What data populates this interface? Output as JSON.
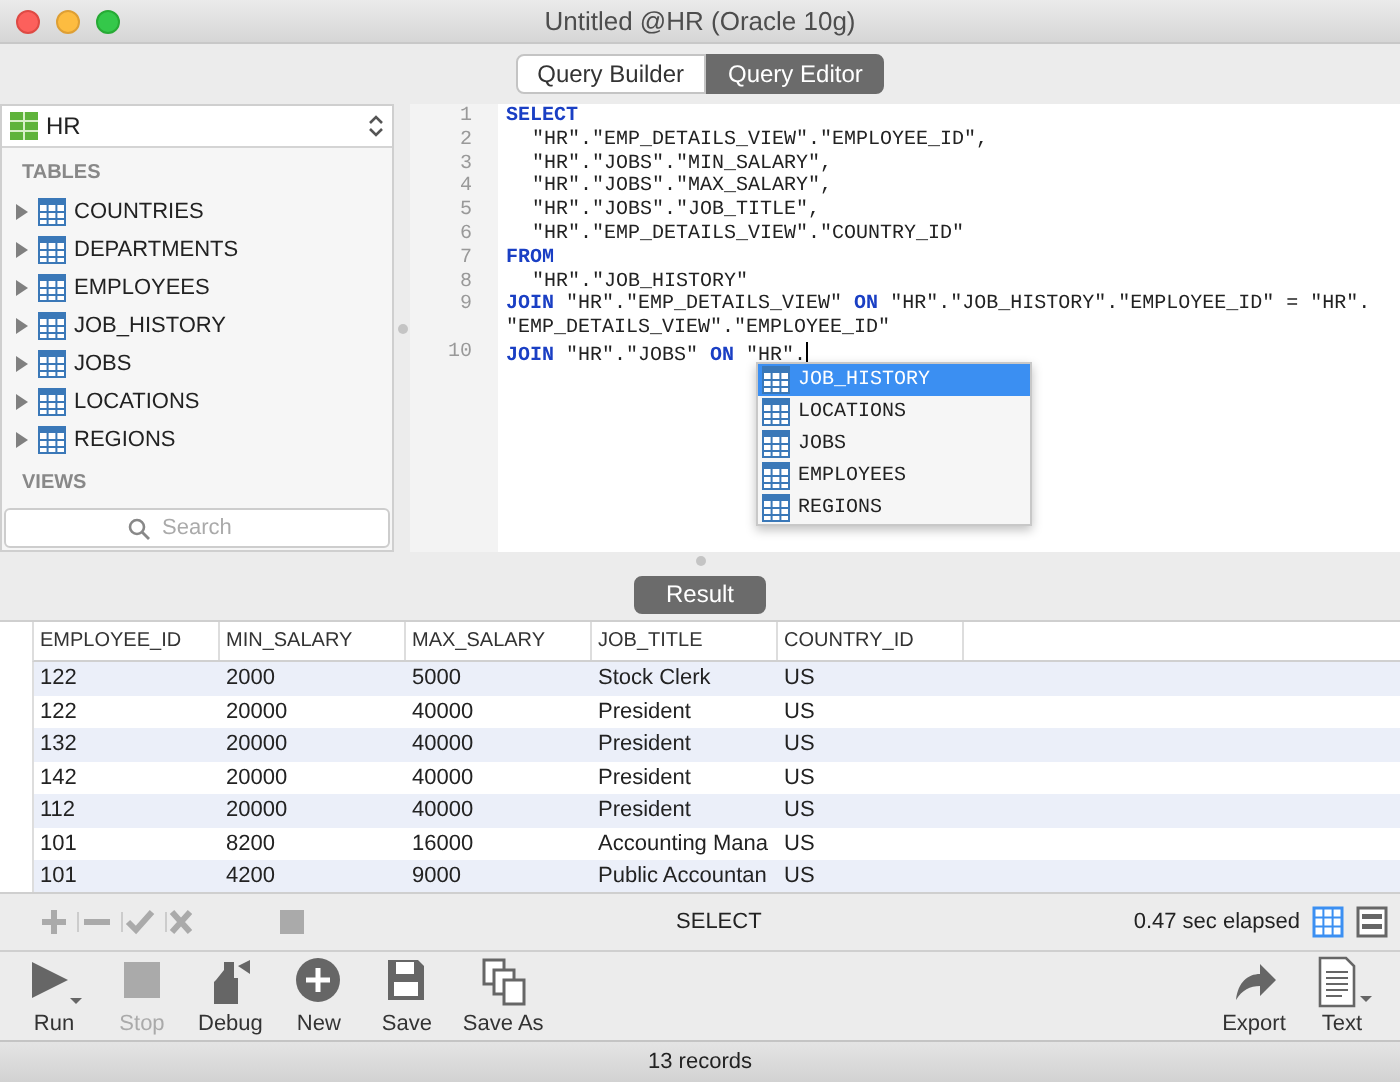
{
  "window": {
    "title": "Untitled @HR (Oracle 10g)"
  },
  "tabs": [
    {
      "label": "Query Builder",
      "selected": false
    },
    {
      "label": "Query Editor",
      "selected": true
    }
  ],
  "sidebar": {
    "schema": "HR",
    "sections": [
      {
        "title": "TABLES",
        "items": [
          {
            "label": "COUNTRIES",
            "expanded": false
          },
          {
            "label": "DEPARTMENTS",
            "expanded": false
          },
          {
            "label": "EMPLOYEES",
            "expanded": false
          },
          {
            "label": "JOB_HISTORY",
            "expanded": false
          },
          {
            "label": "JOBS",
            "expanded": false
          },
          {
            "label": "LOCATIONS",
            "expanded": false
          },
          {
            "label": "REGIONS",
            "expanded": false
          }
        ]
      },
      {
        "title": "VIEWS"
      }
    ],
    "search": {
      "placeholder": "Search"
    }
  },
  "editor": {
    "lines": [
      {
        "number": "1",
        "indented": false,
        "tokens": [
          {
            "kind": "keyword",
            "text": "SELECT"
          }
        ]
      },
      {
        "number": "2",
        "indented": true,
        "tokens": [
          {
            "kind": "text",
            "text": "\"HR\".\"EMP_DETAILS_VIEW\".\"EMPLOYEE_ID\","
          }
        ]
      },
      {
        "number": "3",
        "indented": true,
        "tokens": [
          {
            "kind": "text",
            "text": "\"HR\".\"JOBS\".\"MIN_SALARY\","
          }
        ]
      },
      {
        "number": "4",
        "indented": true,
        "tokens": [
          {
            "kind": "text",
            "text": "\"HR\".\"JOBS\".\"MAX_SALARY\","
          }
        ]
      },
      {
        "number": "5",
        "indented": true,
        "tokens": [
          {
            "kind": "text",
            "text": "\"HR\".\"JOBS\".\"JOB_TITLE\","
          }
        ]
      },
      {
        "number": "6",
        "indented": true,
        "tokens": [
          {
            "kind": "text",
            "text": "\"HR\".\"EMP_DETAILS_VIEW\".\"COUNTRY_ID\""
          }
        ]
      },
      {
        "number": "7",
        "indented": false,
        "tokens": [
          {
            "kind": "keyword",
            "text": "FROM"
          }
        ]
      },
      {
        "number": "8",
        "indented": true,
        "tokens": [
          {
            "kind": "text",
            "text": "\"HR\".\"JOB_HISTORY\""
          }
        ]
      },
      {
        "number": "9",
        "indented": false,
        "tokens": [
          {
            "kind": "keyword",
            "text": "JOIN"
          },
          {
            "kind": "text",
            "text": " \"HR\".\"EMP_DETAILS_VIEW\" "
          },
          {
            "kind": "keyword",
            "text": "ON"
          },
          {
            "kind": "text",
            "text": " \"HR\".\"JOB_HISTORY\".\"EMPLOYEE_ID\" = \"HR\"."
          }
        ]
      },
      {
        "indented": false,
        "tokens": [
          {
            "kind": "text",
            "text": "\"EMP_DETAILS_VIEW\".\"EMPLOYEE_ID\""
          }
        ]
      },
      {
        "number": "10",
        "indented": false,
        "tokens": [
          {
            "kind": "keyword",
            "text": "JOIN"
          },
          {
            "kind": "text",
            "text": " \"HR\".\"JOBS\" "
          },
          {
            "kind": "keyword",
            "text": "ON"
          },
          {
            "kind": "text",
            "text": " \"HR\"."
          }
        ]
      }
    ],
    "autocomplete": [
      {
        "label": "JOB_HISTORY",
        "selected": true
      },
      {
        "label": "LOCATIONS",
        "selected": false
      },
      {
        "label": "JOBS",
        "selected": false
      },
      {
        "label": "EMPLOYEES",
        "selected": false
      },
      {
        "label": "REGIONS",
        "selected": false
      }
    ]
  },
  "result_button": "Result",
  "table": {
    "columns": [
      "EMPLOYEE_ID",
      "MIN_SALARY",
      "MAX_SALARY",
      "JOB_TITLE",
      "COUNTRY_ID"
    ],
    "rows": [
      [
        "122",
        "2000",
        "5000",
        "Stock Clerk",
        "US"
      ],
      [
        "122",
        "20000",
        "40000",
        "President",
        "US"
      ],
      [
        "132",
        "20000",
        "40000",
        "President",
        "US"
      ],
      [
        "142",
        "20000",
        "40000",
        "President",
        "US"
      ],
      [
        "112",
        "20000",
        "40000",
        "President",
        "US"
      ],
      [
        "101",
        "8200",
        "16000",
        "Accounting Mana",
        "US"
      ],
      [
        "101",
        "4200",
        "9000",
        "Public Accountan",
        "US"
      ]
    ]
  },
  "edit_bar": {
    "statement": "SELECT",
    "elapsed": "0.47 sec elapsed",
    "views": [
      {
        "kind": "grid",
        "selected": true
      },
      {
        "kind": "form",
        "selected": false
      }
    ]
  },
  "toolbar": {
    "left": [
      {
        "kind": "run",
        "label": "Run",
        "disabled": false
      },
      {
        "kind": "stop",
        "label": "Stop",
        "disabled": true
      },
      {
        "kind": "debug",
        "label": "Debug",
        "disabled": false
      },
      {
        "kind": "new",
        "label": "New",
        "disabled": false
      },
      {
        "kind": "save",
        "label": "Save",
        "disabled": false
      },
      {
        "kind": "saveas",
        "label": "Save As",
        "disabled": false
      }
    ],
    "right": [
      {
        "kind": "export",
        "label": "Export",
        "disabled": false
      },
      {
        "kind": "text",
        "label": "Text",
        "disabled": false
      }
    ]
  },
  "status_bar": "13 records"
}
